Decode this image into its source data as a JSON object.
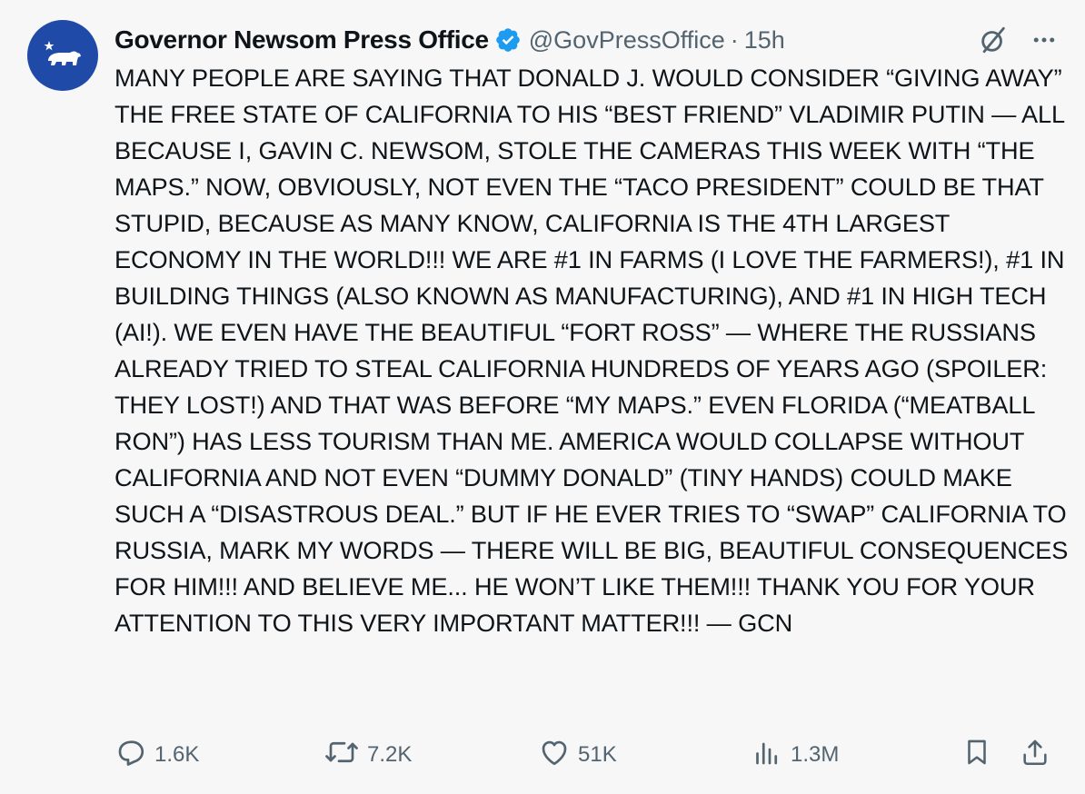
{
  "tweet": {
    "author_name": "Governor Newsom Press Office",
    "handle": "@GovPressOffice",
    "separator": "·",
    "time": "15h",
    "text": "MANY PEOPLE ARE SAYING THAT DONALD J. WOULD CONSIDER “GIVING AWAY” THE FREE STATE OF CALIFORNIA TO HIS “BEST FRIEND” VLADIMIR PUTIN — ALL BECAUSE I, GAVIN C. NEWSOM, STOLE THE CAMERAS THIS WEEK WITH “THE MAPS.” NOW, OBVIOUSLY, NOT EVEN THE “TACO PRESIDENT” COULD BE THAT STUPID, BECAUSE AS MANY KNOW, CALIFORNIA IS THE 4TH LARGEST ECONOMY IN THE WORLD!!! WE ARE #1 IN FARMS (I LOVE THE FARMERS!), #1 IN BUILDING THINGS (ALSO KNOWN AS MANUFACTURING), AND #1 IN HIGH TECH (AI!). WE EVEN HAVE THE BEAUTIFUL “FORT ROSS” — WHERE THE RUSSIANS ALREADY TRIED TO STEAL CALIFORNIA HUNDREDS OF YEARS AGO (SPOILER: THEY LOST!) AND THAT WAS BEFORE “MY MAPS.” EVEN FLORIDA (“MEATBALL RON”) HAS LESS TOURISM THAN ME. AMERICA WOULD COLLAPSE WITHOUT CALIFORNIA AND NOT EVEN “DUMMY DONALD” (TINY HANDS) COULD MAKE SUCH A “DISASTROUS DEAL.” BUT IF HE EVER TRIES TO “SWAP” CALIFORNIA TO RUSSIA, MARK MY WORDS — THERE WILL BE BIG, BEAUTIFUL CONSEQUENCES FOR HIM!!! AND BELIEVE ME... HE WON’T LIKE THEM!!! THANK YOU FOR YOUR ATTENTION TO THIS VERY IMPORTANT MATTER!!! — GCN"
  },
  "actions": {
    "replies": "1.6K",
    "reposts": "7.2K",
    "likes": "51K",
    "views": "1.3M"
  },
  "icons": {
    "avatar": "california-bear-flag-icon",
    "verified": "verified-badge-icon",
    "grok": "grok-icon",
    "more": "more-icon",
    "reply": "reply-icon",
    "repost": "repost-icon",
    "like": "like-icon",
    "views": "views-icon",
    "bookmark": "bookmark-icon",
    "share": "share-icon"
  },
  "colors": {
    "background": "#f7f7f7",
    "avatar_bg": "#1f4aa8",
    "verified_blue": "#1d9bf0",
    "text": "#0f1419",
    "muted": "#536471"
  }
}
